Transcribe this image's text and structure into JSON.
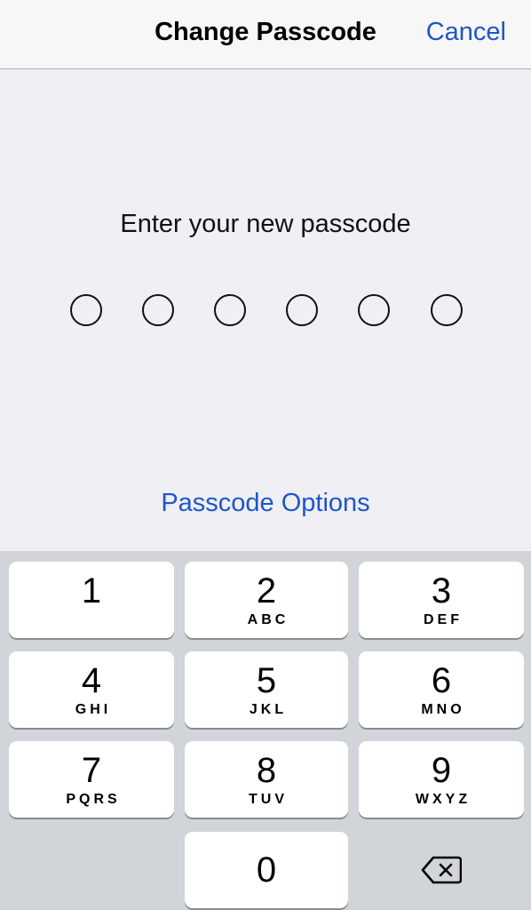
{
  "header": {
    "title": "Change Passcode",
    "cancel_label": "Cancel"
  },
  "main": {
    "prompt": "Enter your new passcode",
    "passcode_length": 6,
    "digits_entered": 0,
    "options_label": "Passcode Options"
  },
  "keypad": {
    "keys": [
      {
        "digit": "1",
        "letters": ""
      },
      {
        "digit": "2",
        "letters": "ABC"
      },
      {
        "digit": "3",
        "letters": "DEF"
      },
      {
        "digit": "4",
        "letters": "GHI"
      },
      {
        "digit": "5",
        "letters": "JKL"
      },
      {
        "digit": "6",
        "letters": "MNO"
      },
      {
        "digit": "7",
        "letters": "PQRS"
      },
      {
        "digit": "8",
        "letters": "TUV"
      },
      {
        "digit": "9",
        "letters": "WXYZ"
      },
      {
        "digit": "0",
        "letters": ""
      }
    ],
    "delete_icon": "backspace-icon"
  },
  "colors": {
    "accent": "#1e56c8",
    "background": "#efeff4",
    "keyboard": "#d1d4d9"
  }
}
